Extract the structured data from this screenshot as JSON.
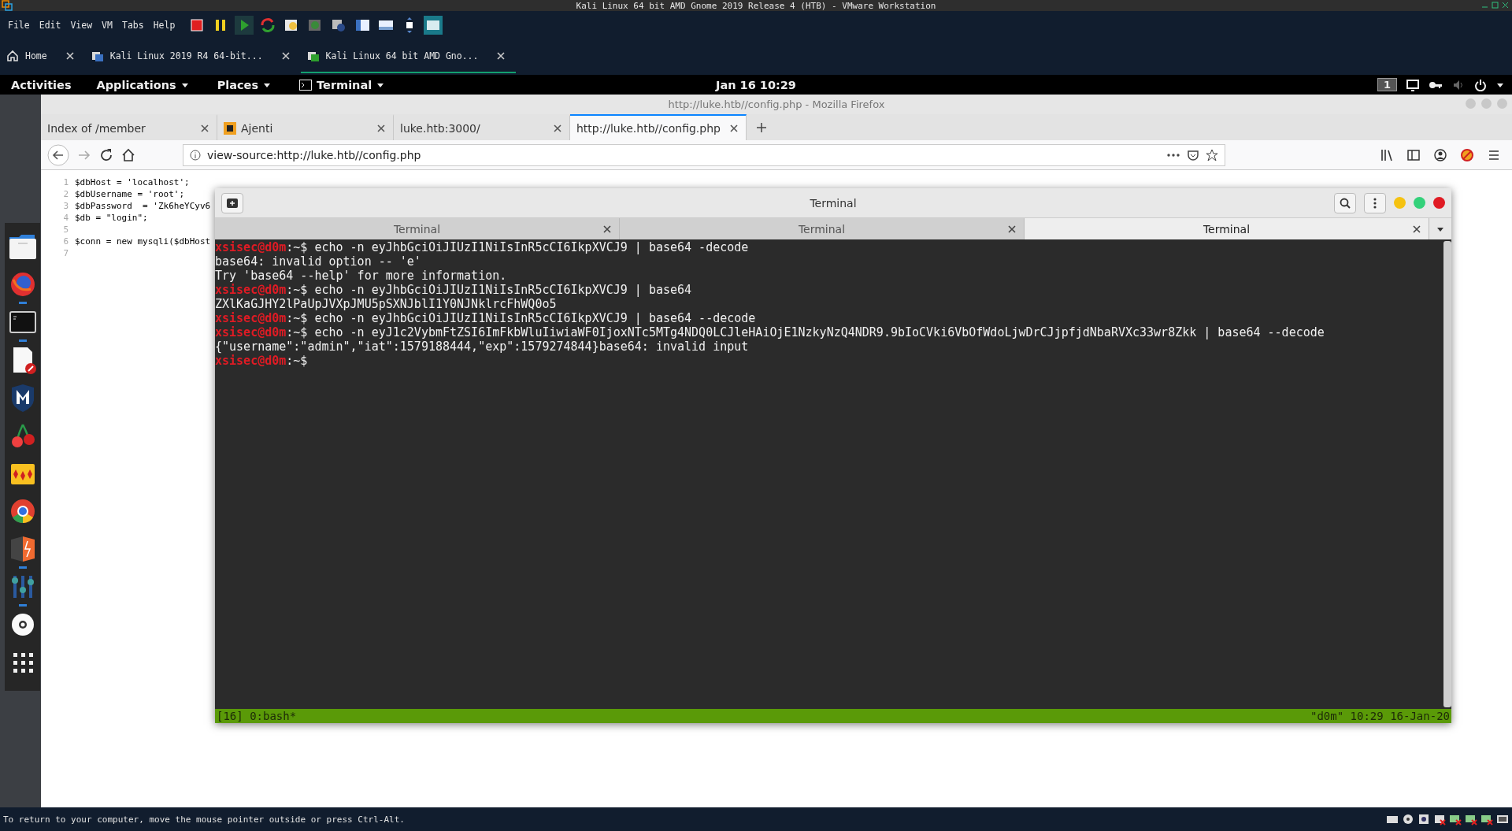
{
  "vmware": {
    "title": "Kali Linux 64 bit AMD Gnome 2019 Release 4 (HTB) - VMware Workstation",
    "menu": [
      "File",
      "Edit",
      "View",
      "VM",
      "Tabs",
      "Help"
    ],
    "tabs": [
      {
        "label": "Home",
        "kind": "home",
        "selected": false
      },
      {
        "label": "Kali Linux 2019 R4 64-bit...",
        "kind": "vm",
        "selected": false
      },
      {
        "label": "Kali Linux 64 bit AMD Gno...",
        "kind": "vm",
        "selected": true
      }
    ],
    "status": "To return to your computer, move the mouse pointer outside or press Ctrl-Alt."
  },
  "gnome_bar": {
    "activities": "Activities",
    "menus": [
      "Applications",
      "Places",
      "Terminal"
    ],
    "clock": "Jan 16  10:29",
    "workspace": "1"
  },
  "dock": {
    "items": [
      {
        "kind": "files",
        "running": false
      },
      {
        "kind": "firefox",
        "running": true
      },
      {
        "kind": "terminal",
        "running": true
      },
      {
        "kind": "editor",
        "running": false
      },
      {
        "kind": "shield",
        "running": false
      },
      {
        "kind": "cherry",
        "running": false
      },
      {
        "kind": "diamonds",
        "running": false
      },
      {
        "kind": "chrome",
        "running": false
      },
      {
        "kind": "burp",
        "running": true
      },
      {
        "kind": "mixer",
        "running": true
      },
      {
        "kind": "disc",
        "running": false
      },
      {
        "kind": "grid",
        "running": false
      }
    ]
  },
  "firefox": {
    "title": "http://luke.htb//config.php - Mozilla Firefox",
    "tabs": [
      {
        "label": "Index of /member",
        "kind": "plain",
        "selected": false
      },
      {
        "label": "Ajenti",
        "kind": "ajenti",
        "selected": false
      },
      {
        "label": "luke.htb:3000/",
        "kind": "plain",
        "selected": false
      },
      {
        "label": "http://luke.htb//config.php",
        "kind": "plain",
        "selected": true
      }
    ],
    "url": "view-source:http://luke.htb//config.php",
    "source_lines": [
      {
        "number": "1",
        "text": "$dbHost = 'localhost';"
      },
      {
        "number": "2",
        "text": "$dbUsername = 'root';"
      },
      {
        "number": "3",
        "text": "$dbPassword  = 'Zk6heYCyv6"
      },
      {
        "number": "4",
        "text": "$db = \"login\";"
      },
      {
        "number": "5"
      },
      {
        "number": "6",
        "text": "$conn = new mysqli($dbHost"
      },
      {
        "number": "7"
      }
    ]
  },
  "terminal": {
    "title": "Terminal",
    "tabs": [
      {
        "label": "Terminal",
        "selected": false
      },
      {
        "label": "Terminal",
        "selected": false
      },
      {
        "label": "Terminal",
        "selected": true
      }
    ],
    "lines": [
      {
        "kind": "prompt",
        "user": "xsisec@d0m",
        "path": ":~$ ",
        "command": "echo -n eyJhbGciOiJIUzI1NiIsInR5cCI6IkpXVCJ9 | base64 -decode"
      },
      {
        "kind": "output",
        "text": "base64: invalid option -- 'e'"
      },
      {
        "kind": "output",
        "text": "Try 'base64 --help' for more information."
      },
      {
        "kind": "prompt",
        "user": "xsisec@d0m",
        "path": ":~$ ",
        "command": "echo -n eyJhbGciOiJIUzI1NiIsInR5cCI6IkpXVCJ9 | base64"
      },
      {
        "kind": "output",
        "text": "ZXlKaGJHY2lPaUpJVXpJMU5pSXNJblI1Y0NJNklrcFhWQ0o5"
      },
      {
        "kind": "prompt",
        "user": "xsisec@d0m",
        "path": ":~$ ",
        "command": "echo -n eyJhbGciOiJIUzI1NiIsInR5cCI6IkpXVCJ9 | base64 --decode"
      },
      {
        "kind": "prompt",
        "user": "xsisec@d0m",
        "path": ":~$ ",
        "command": "echo -n eyJ1c2VybmFtZSI6ImFkbWluIiwiaWF0IjoxNTc5MTg4NDQ0LCJleHAiOjE1NzkyNzQ4NDR9.9bIoCVki6VbOfWdoLjwDrCJjpfjdNbaRVXc33wr8Zkk | base64 --decode"
      },
      {
        "kind": "output",
        "text": "{\"username\":\"admin\",\"iat\":1579188444,\"exp\":1579274844}base64: invalid input"
      },
      {
        "kind": "prompt",
        "user": "xsisec@d0m",
        "path": ":~$"
      }
    ],
    "status_left": "[16] 0:bash*",
    "status_right": "\"d0m\" 10:29 16-Jan-20"
  }
}
